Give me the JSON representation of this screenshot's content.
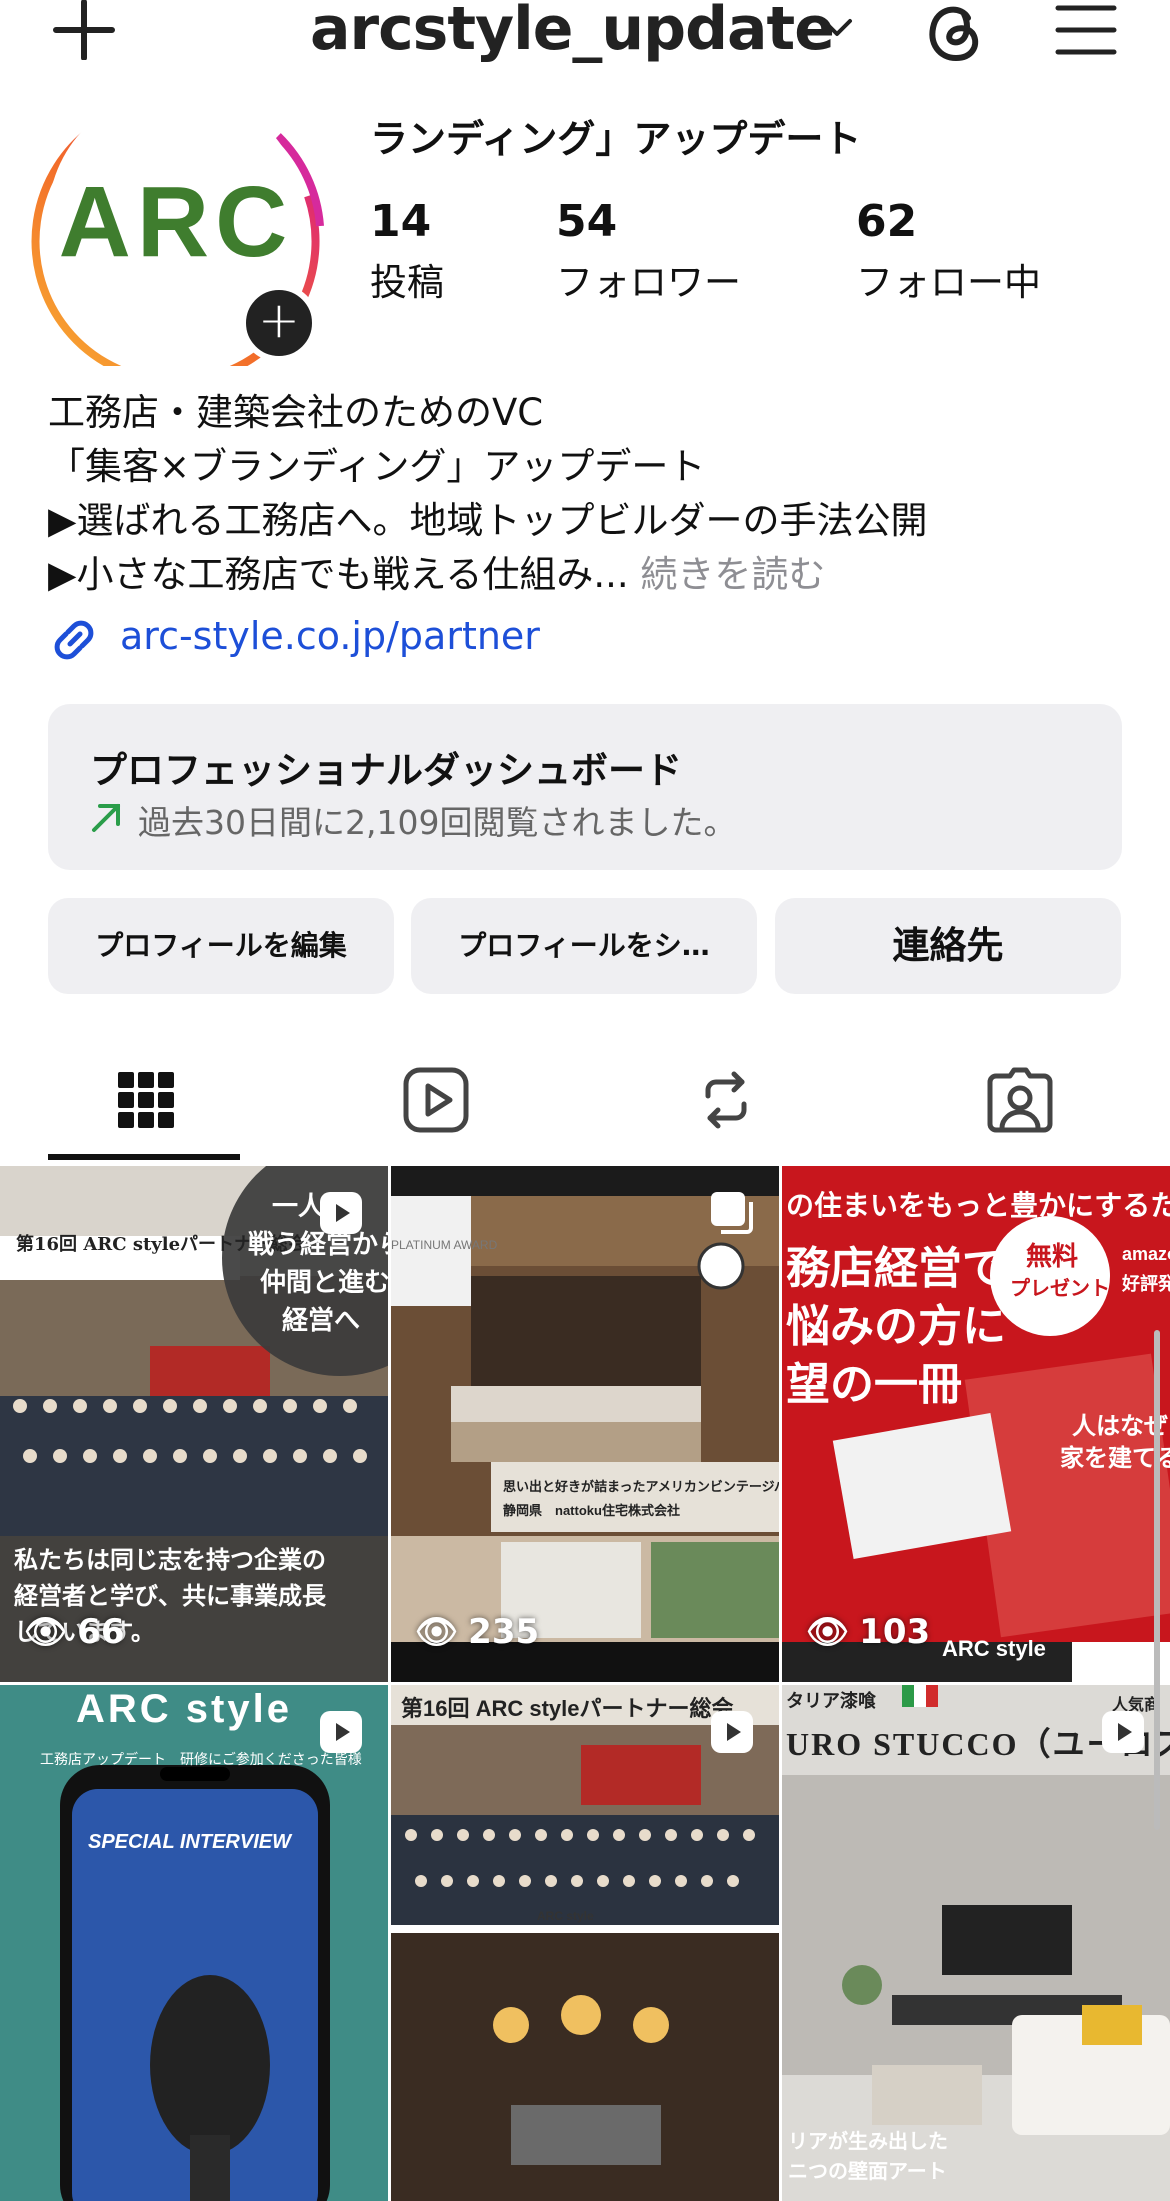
{
  "header": {
    "username": "arcstyle_update"
  },
  "profile": {
    "avatar_text": "ARC",
    "category_line": "ランディング」アップデート",
    "stats": [
      {
        "value": "14",
        "label": "投稿"
      },
      {
        "value": "54",
        "label": "フォロワー"
      },
      {
        "value": "62",
        "label": "フォロー中"
      }
    ],
    "bio": [
      "工務店・建築会社のためのVC",
      "「集客×ブランディング」アップデート",
      "▶選ばれる工務店へ。地域トップビルダーの手法公開",
      "▶小さな工務店でも戦える仕組み... "
    ],
    "more_label": "続きを読む",
    "link": "arc-style.co.jp/partner"
  },
  "dashboard": {
    "title": "プロフェッショナルダッシュボード",
    "subtitle": "過去30日間に2,109回閲覧されました。"
  },
  "buttons": {
    "edit": "プロフィールを編集",
    "share": "プロフィールをシ…",
    "contact": "連絡先"
  },
  "grid": {
    "posts": [
      {
        "views": "66",
        "caption_top": "一人で",
        "caption_mid1": "戦う経営から",
        "caption_mid2": "仲間と進む",
        "caption_mid3": "経営へ",
        "banner": "第16回 ARC styleパートナー総会",
        "text1": "私たちは同じ志を持つ企業の",
        "text2": "経営者と学び、共に事業成長",
        "text3": "しています。"
      },
      {
        "views": "235",
        "overlay1": "思い出と好きが詰まったアメリカンビンテージハウ",
        "overlay2": "静岡県　nattoku住宅株式会社",
        "award": "PLATINUM AWARD"
      },
      {
        "views": "103",
        "head": "の住まいをもっと豊かにするため",
        "l1": "務店経営で",
        "l2": "悩みの方に",
        "l3": "望の一冊",
        "badge1": "無料",
        "badge2": "プレゼント",
        "book": "人はなぜ「",
        "book2": "家を建てるの",
        "brand": "ARC style",
        "amazon": "amazo",
        "amazon2": "好評発"
      },
      {
        "title": "ARC style",
        "sub": "工務店アップデート　研修にご参加くださった皆様",
        "interview": "SPECIAL INTERVIEW"
      },
      {
        "banner": "第16回 ARC styleパートナー総会",
        "sign": "ARC style"
      },
      {
        "head": "タリア漆喰",
        "title": "URO STUCCO（ユーロス",
        "right": "人気商",
        "f1": "リアが生み出した",
        "f2": "ニつの壁面アート"
      }
    ]
  },
  "colors": {
    "accent_blue": "#1d4fd8",
    "arc_green": "#3f7d2e",
    "panel": "#efeff2"
  }
}
